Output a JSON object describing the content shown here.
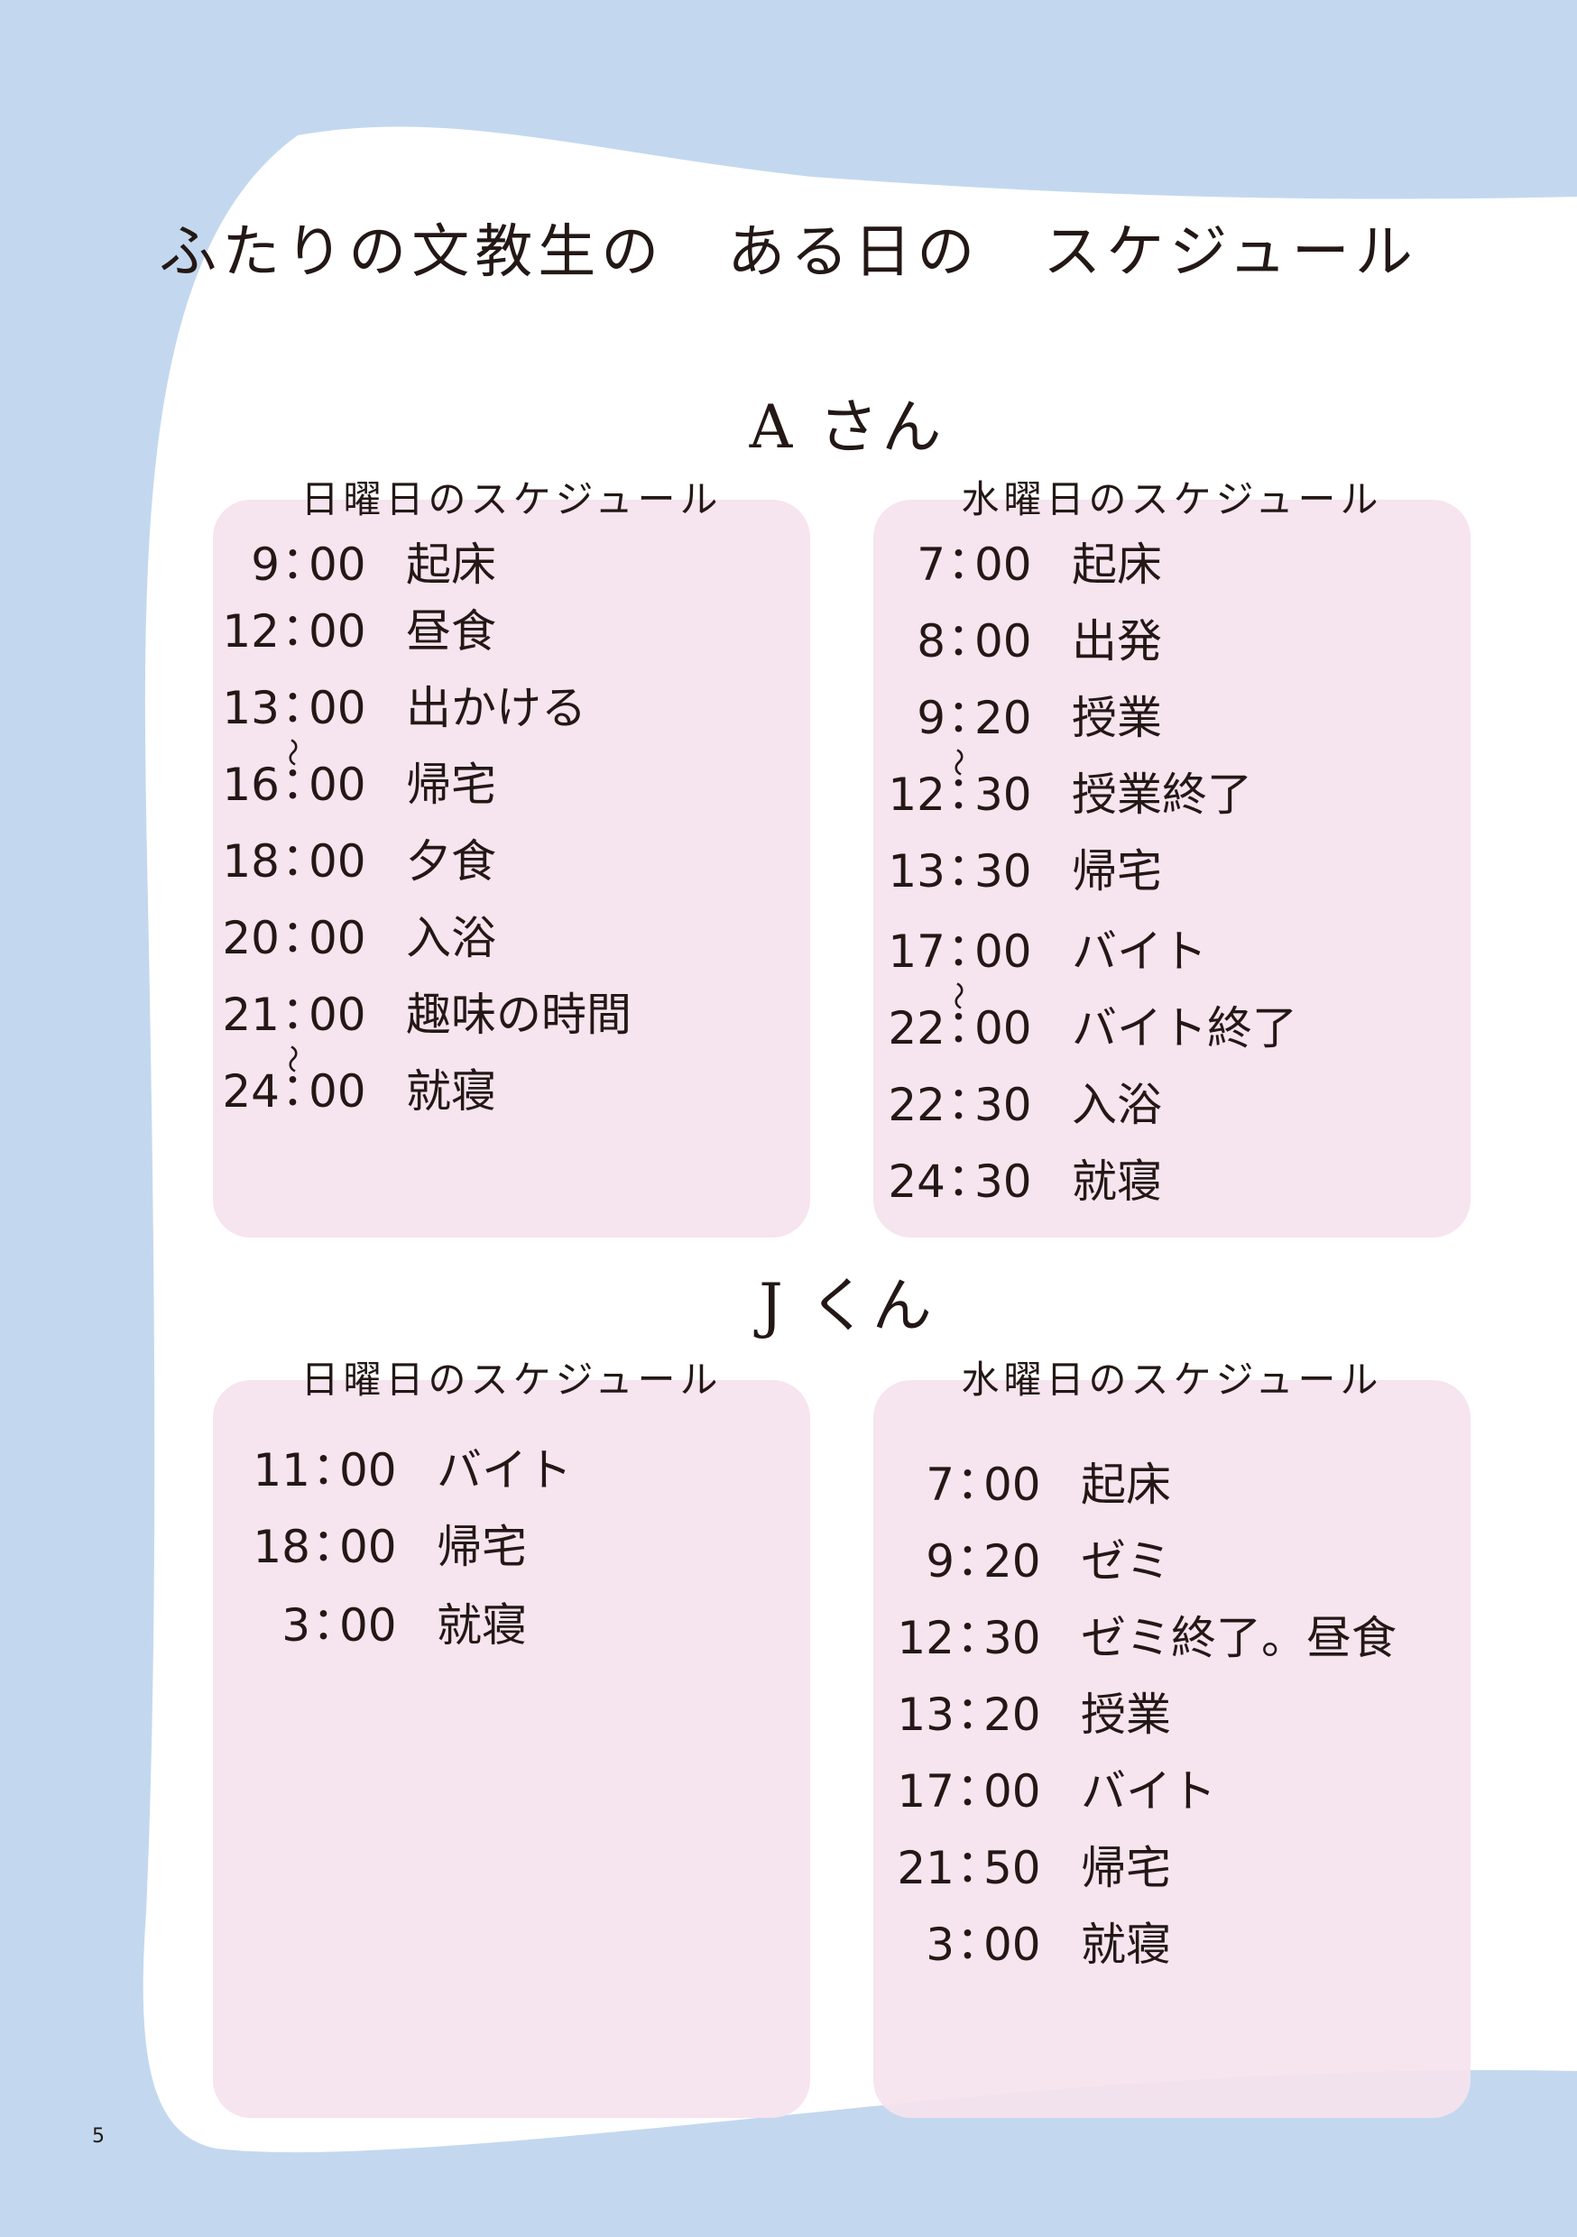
{
  "title": "ふたりの文教生の　ある日の　スケジュール",
  "page_number": "5",
  "persons": [
    {
      "name": "A さん",
      "schedules": [
        {
          "title": "日曜日のスケジュール",
          "entries": [
            {
              "hh": "9",
              "mm": "00",
              "activity": "起床"
            },
            {
              "hh": "12",
              "mm": "00",
              "activity": "昼食"
            },
            {
              "hh": "13",
              "mm": "00",
              "activity": "出かける"
            },
            {
              "hh": "16",
              "mm": "00",
              "activity": "帰宅"
            },
            {
              "hh": "18",
              "mm": "00",
              "activity": "夕食"
            },
            {
              "hh": "20",
              "mm": "00",
              "activity": "入浴"
            },
            {
              "hh": "21",
              "mm": "00",
              "activity": "趣味の時間"
            },
            {
              "hh": "24",
              "mm": "00",
              "activity": "就寝"
            }
          ]
        },
        {
          "title": "水曜日のスケジュール",
          "entries": [
            {
              "hh": "7",
              "mm": "00",
              "activity": "起床"
            },
            {
              "hh": "8",
              "mm": "00",
              "activity": "出発"
            },
            {
              "hh": "9",
              "mm": "20",
              "activity": "授業"
            },
            {
              "hh": "12",
              "mm": "30",
              "activity": "授業終了"
            },
            {
              "hh": "13",
              "mm": "30",
              "activity": "帰宅"
            },
            {
              "hh": "17",
              "mm": "00",
              "activity": "バイト"
            },
            {
              "hh": "22",
              "mm": "00",
              "activity": "バイト終了"
            },
            {
              "hh": "22",
              "mm": "30",
              "activity": "入浴"
            },
            {
              "hh": "24",
              "mm": "30",
              "activity": "就寝"
            }
          ]
        }
      ]
    },
    {
      "name": "J くん",
      "schedules": [
        {
          "title": "日曜日のスケジュール",
          "entries": [
            {
              "hh": "11",
              "mm": "00",
              "activity": "バイト"
            },
            {
              "hh": "18",
              "mm": "00",
              "activity": "帰宅"
            },
            {
              "hh": "3",
              "mm": "00",
              "activity": "就寝"
            }
          ]
        },
        {
          "title": "水曜日のスケジュール",
          "entries": [
            {
              "hh": "7",
              "mm": "00",
              "activity": "起床"
            },
            {
              "hh": "9",
              "mm": "20",
              "activity": "ゼミ"
            },
            {
              "hh": "12",
              "mm": "30",
              "activity": "ゼミ終了。昼食"
            },
            {
              "hh": "13",
              "mm": "20",
              "activity": "授業"
            },
            {
              "hh": "17",
              "mm": "00",
              "activity": "バイト"
            },
            {
              "hh": "21",
              "mm": "50",
              "activity": "帰宅"
            },
            {
              "hh": "3",
              "mm": "00",
              "activity": "就寝"
            }
          ]
        }
      ]
    }
  ],
  "colon_char": "：",
  "range_mark": "～",
  "colors": {
    "background": "#c3d8ef",
    "page": "#ffffff",
    "card": "#f5e2ee",
    "side_tab_upper": "#e2e7c8",
    "side_tab_lower": "#dcebc7",
    "text": "#231815"
  }
}
